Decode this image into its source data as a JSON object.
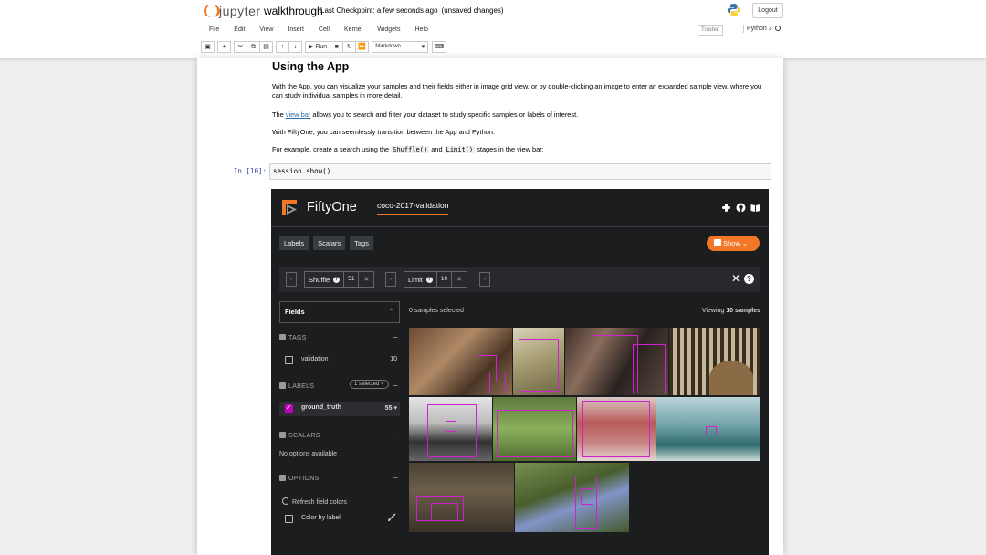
{
  "header": {
    "logo_text": "jupyter",
    "notebook_name": "walkthrough",
    "checkpoint": "Last Checkpoint: a few seconds ago",
    "unsaved": "(unsaved changes)",
    "logout_label": "Logout"
  },
  "menubar": {
    "items": [
      "File",
      "Edit",
      "View",
      "Insert",
      "Cell",
      "Kernel",
      "Widgets",
      "Help"
    ],
    "trusted": "Trusted",
    "kernel": "Python 3"
  },
  "toolbar": {
    "run_label": "Run",
    "cell_type": "Markdown"
  },
  "markdown": {
    "heading": "Using the App",
    "p1": "With the App, you can visualize your samples and their fields either in image grid view, or by double-clicking an image to enter an expanded sample view, where you can study individual samples in more detail.",
    "p2_before": "The ",
    "p2_link": "view bar",
    "p2_after": " allows you to search and filter your dataset to study specific samples or labels of interest.",
    "p3": "With FiftyOne, you can seemlessly transition between the App and Python.",
    "p4_before": "For example, create a search using the ",
    "p4_code1": "Shuffle()",
    "p4_mid": " and ",
    "p4_code2": "Limit()",
    "p4_after": " stages in the view bar:"
  },
  "cell": {
    "prompt": "In [10]:",
    "code": "session.show()"
  },
  "fiftyone": {
    "title": "FiftyOne",
    "dataset": "coco-2017-validation",
    "tabs": [
      "Labels",
      "Scalars",
      "Tags"
    ],
    "show_label": "Show",
    "stages": [
      {
        "name": "Shuffle",
        "value": "51"
      },
      {
        "name": "Limit",
        "value": "10"
      }
    ],
    "fields_label": "Fields",
    "tags_header": "TAGS",
    "tag_item": {
      "label": "validation",
      "count": "10"
    },
    "labels_header": "LABELS",
    "labels_selected": "1 selected ×",
    "label_item": {
      "label": "ground_truth",
      "count": "55 ▾"
    },
    "scalars_header": "SCALARS",
    "no_options": "No options available",
    "options_header": "OPTIONS",
    "refresh_colors": "Refresh field colors",
    "color_by_label": "Color by label",
    "samples_selected": "0 samples selected",
    "viewing_prefix": "Viewing ",
    "viewing_count": "10 samples"
  },
  "colors": {
    "orange": "#f37726",
    "label_magenta": "#d020d0",
    "app_bg": "#1b1d1f"
  }
}
